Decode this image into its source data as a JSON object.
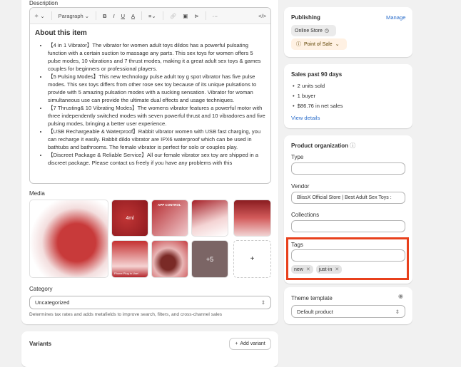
{
  "description": {
    "label": "Description",
    "toolbar": {
      "paragraph": "Paragraph",
      "bold": "B",
      "italic": "I",
      "underline": "U",
      "color": "A",
      "more": "···",
      "code": "</>"
    },
    "heading": "About this item",
    "bullets": [
      "【4 in 1 Vibrator】The vibrator for women adult toys dildos has a powerful pulsating function with a certain suction to massage any parts. This sex toys for women offers 5 pulse modes, 10 vibrations and 7 thrust modes, making it a great adult sex toys & games couples for beginners or professional players.",
      "【5 Pulsing Modes】This new technology pulse adult toy g spot vibrator has five pulse modes. This sex toys differs from other rose sex toy because of its unique pulsations to provide with 5 amazing pulsation modes with a sucking sensation. Vibrator for woman simultaneous use can provide the ultimate dual effects and usage techniques.",
      "【7 Thrusting& 10 Vibrating Modes】The womens vibrator features a powerful motor with three independently switched modes with seven powerful thrust and 10 vibradores and five pulsing modes, bringing a better user experience.",
      "【USB Rechargeable & Waterproof】Rabbit vibrator women with USB fast charging, you can recharge it easily. Rabbit dildo vibrator are IPX6 waterproof which can be used in bathtubs and bathrooms. The female vibrator is perfect for solo or couples play.",
      "【Discreet Package & Reliable Service】All our female vibrator sex toy are shipped in a discreet package. Please contact us freely if you have any problems with this"
    ]
  },
  "media": {
    "label": "Media",
    "more_count": "+5",
    "add": "+",
    "thumb_texts": [
      "4ml",
      "APP CONTROL",
      "Phone Plug in Use!"
    ]
  },
  "category": {
    "label": "Category",
    "value": "Uncategorized",
    "help": "Determines tax rates and adds metafields to improve search, filters, and cross-channel sales"
  },
  "variants": {
    "label": "Variants",
    "add_label": "Add variant"
  },
  "publishing": {
    "title": "Publishing",
    "manage": "Manage",
    "channels": [
      "Online Store",
      "Point of Sale"
    ]
  },
  "sales": {
    "title": "Sales past 90 days",
    "items": [
      "2 units sold",
      "1 buyer",
      "$86.76 in net sales"
    ],
    "link": "View details"
  },
  "organization": {
    "title": "Product organization",
    "type_label": "Type",
    "type_value": "",
    "vendor_label": "Vendor",
    "vendor_value": "BlissX Official Store | Best Adult Sex Toys :",
    "collections_label": "Collections",
    "collections_value": "",
    "tags_label": "Tags",
    "tags_value": "",
    "tags": [
      "new",
      "just-in"
    ]
  },
  "theme": {
    "title": "Theme template",
    "value": "Default product"
  },
  "colors": {
    "highlight": "#e8401c",
    "link": "#2c6ecb",
    "pos_bg": "#fff1e3"
  }
}
